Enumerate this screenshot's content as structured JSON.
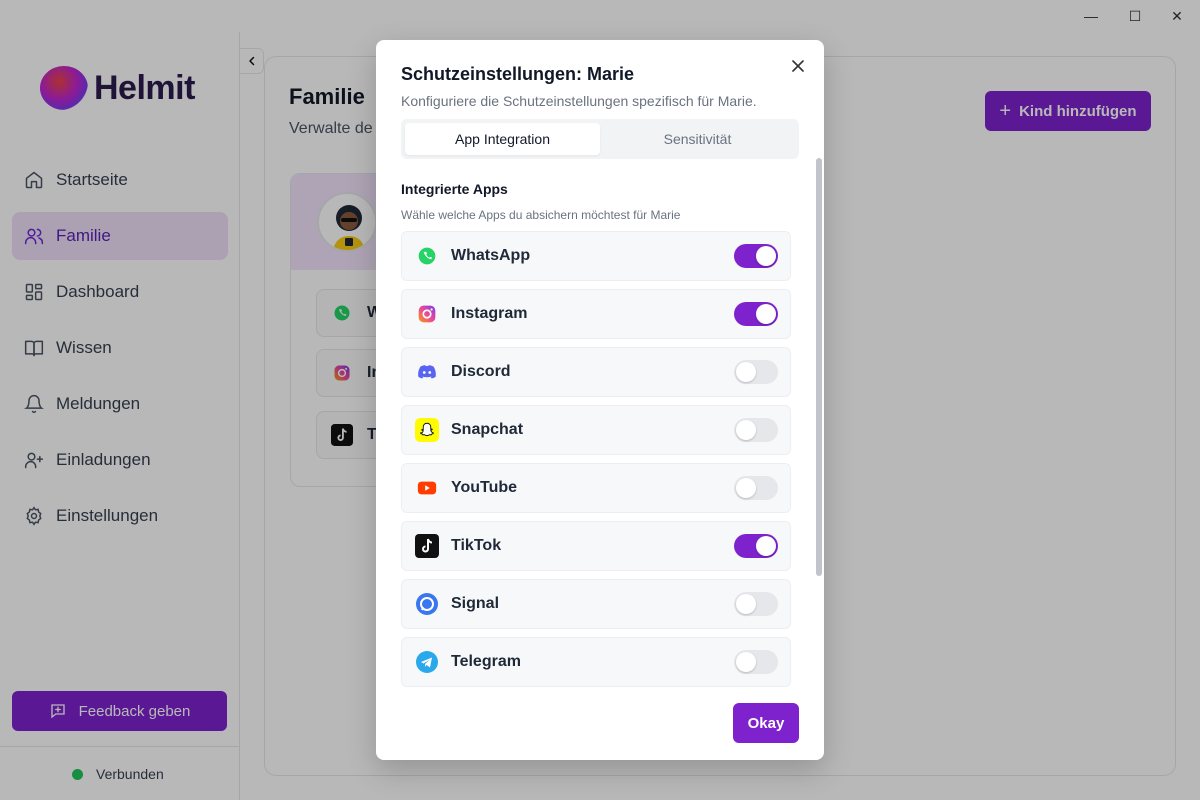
{
  "window": {
    "minimize": "—",
    "maximize": "☐",
    "close": "✕"
  },
  "sidebar": {
    "logo_text": "Helmit",
    "items": [
      {
        "label": "Startseite",
        "icon": "home-icon"
      },
      {
        "label": "Familie",
        "icon": "users-icon",
        "active": true
      },
      {
        "label": "Dashboard",
        "icon": "dashboard-icon"
      },
      {
        "label": "Wissen",
        "icon": "book-icon"
      },
      {
        "label": "Meldungen",
        "icon": "bell-icon"
      },
      {
        "label": "Einladungen",
        "icon": "user-plus-icon"
      },
      {
        "label": "Einstellungen",
        "icon": "gear-icon"
      }
    ],
    "feedback_label": "Feedback geben",
    "status_label": "Verbunden"
  },
  "main": {
    "title": "Familie",
    "subtitle": "Verwalte de",
    "add_button": "Kind hinzufügen",
    "child_card": {
      "apps": [
        {
          "label": "W",
          "icon": "whatsapp-icon"
        },
        {
          "label": "In",
          "icon": "instagram-icon"
        },
        {
          "label": "Ti",
          "icon": "tiktok-icon"
        }
      ]
    }
  },
  "modal": {
    "title": "Schutzeinstellungen: Marie",
    "subtitle": "Konfiguriere die Schutzeinstellungen spezifisch für Marie.",
    "tabs": [
      {
        "label": "App Integration",
        "active": true
      },
      {
        "label": "Sensitivität",
        "active": false
      }
    ],
    "section_title": "Integrierte Apps",
    "section_subtitle": "Wähle welche Apps du absichern möchtest für Marie",
    "apps": [
      {
        "name": "WhatsApp",
        "icon": "whatsapp-icon",
        "enabled": true
      },
      {
        "name": "Instagram",
        "icon": "instagram-icon",
        "enabled": true
      },
      {
        "name": "Discord",
        "icon": "discord-icon",
        "enabled": false
      },
      {
        "name": "Snapchat",
        "icon": "snapchat-icon",
        "enabled": false
      },
      {
        "name": "YouTube",
        "icon": "youtube-icon",
        "enabled": false
      },
      {
        "name": "TikTok",
        "icon": "tiktok-icon",
        "enabled": true
      },
      {
        "name": "Signal",
        "icon": "signal-icon",
        "enabled": false
      },
      {
        "name": "Telegram",
        "icon": "telegram-icon",
        "enabled": false
      }
    ],
    "okay_label": "Okay"
  },
  "colors": {
    "accent": "#7e22ce",
    "active_nav_bg": "#ede0f7",
    "status_green": "#22c55e"
  }
}
